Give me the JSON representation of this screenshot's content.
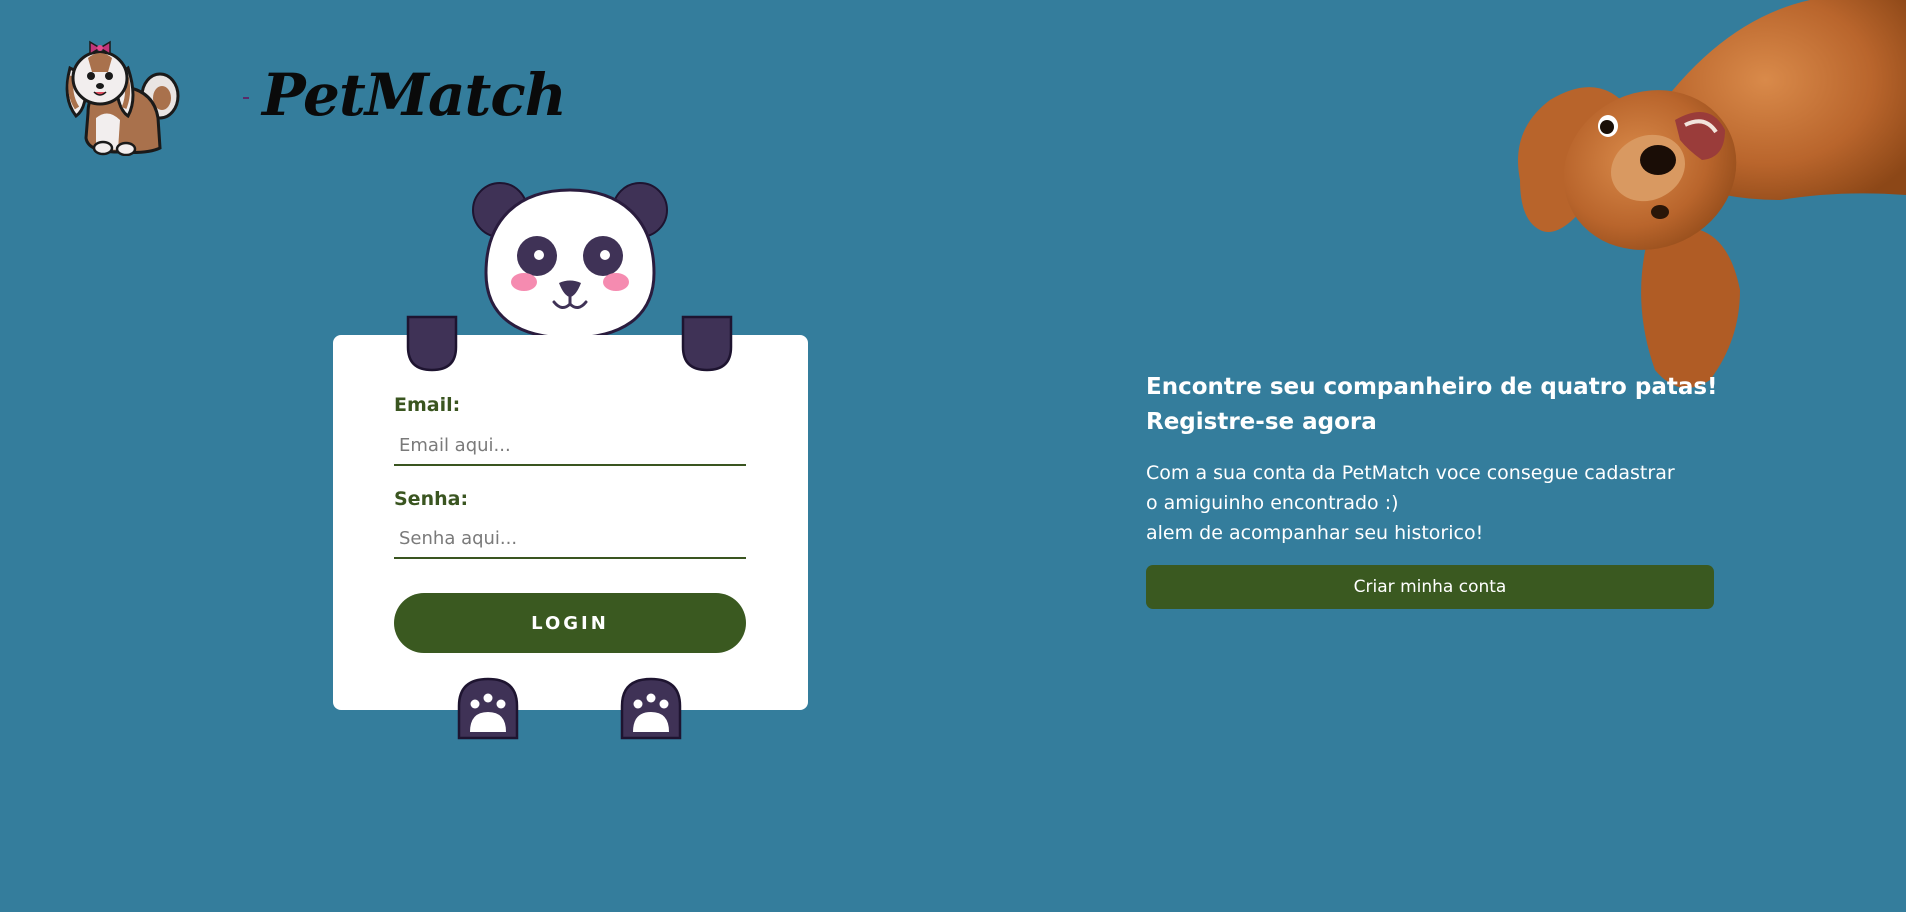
{
  "brand": {
    "name": "PetMatch",
    "logo_icon": "shih-tzu-dog-icon"
  },
  "login": {
    "email_label": "Email:",
    "email_placeholder": "Email aqui...",
    "password_label": "Senha:",
    "password_placeholder": "Senha aqui...",
    "login_button": "LOGIN"
  },
  "promo": {
    "heading_line1": "Encontre seu companheiro de quatro patas!",
    "heading_line2": "Registre-se agora",
    "body_line1": "Com a sua conta da PetMatch voce consegue cadastrar",
    "body_line2": "o amiguinho encontrado :)",
    "body_line3": "alem de acompanhar seu historico!",
    "create_button": "Criar minha conta"
  },
  "colors": {
    "background": "#347d9c",
    "primary_green": "#3a5920",
    "label_green": "#3a5520",
    "panda_dark": "#3f3256",
    "card": "#ffffff"
  }
}
